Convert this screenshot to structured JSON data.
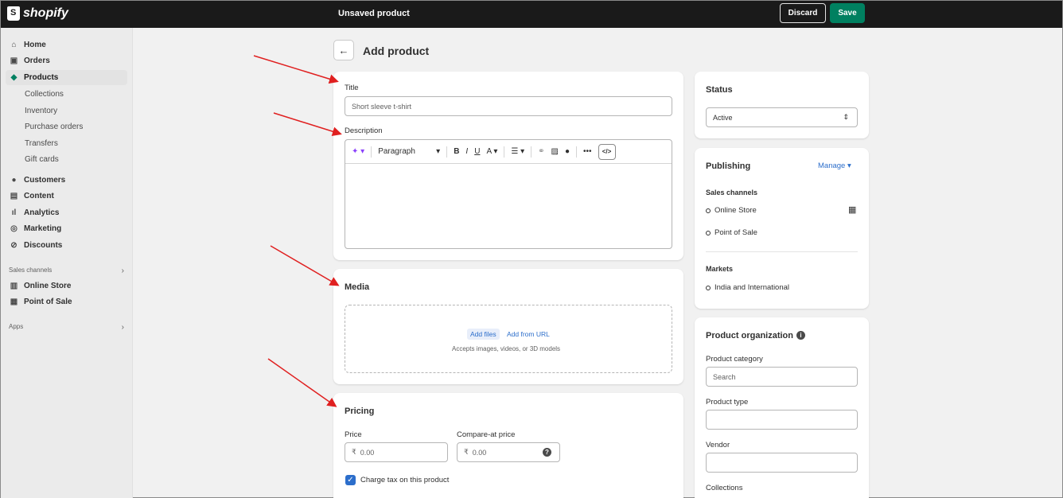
{
  "topbar": {
    "brand": "shopify",
    "status": "Unsaved product",
    "discard": "Discard",
    "save": "Save"
  },
  "sidebar": {
    "home": "Home",
    "orders": "Orders",
    "products": "Products",
    "products_sub": [
      "Collections",
      "Inventory",
      "Purchase orders",
      "Transfers",
      "Gift cards"
    ],
    "customers": "Customers",
    "content": "Content",
    "analytics": "Analytics",
    "marketing": "Marketing",
    "discounts": "Discounts",
    "sales_channels": "Sales channels",
    "online_store": "Online Store",
    "point_of_sale": "Point of Sale",
    "apps": "Apps"
  },
  "page": {
    "title": "Add product"
  },
  "title_field": {
    "label": "Title",
    "placeholder": "Short sleeve t-shirt"
  },
  "description": {
    "label": "Description",
    "paragraph": "Paragraph"
  },
  "media": {
    "heading": "Media",
    "add_files": "Add files",
    "add_from_url": "Add from URL",
    "accepts": "Accepts images, videos, or 3D models"
  },
  "pricing": {
    "heading": "Pricing",
    "price_label": "Price",
    "compare_label": "Compare-at price",
    "currency": "₹",
    "price_placeholder": "0.00",
    "compare_placeholder": "0.00",
    "charge_tax": "Charge tax on this product"
  },
  "status": {
    "heading": "Status",
    "value": "Active"
  },
  "publishing": {
    "heading": "Publishing",
    "manage": "Manage",
    "sales_channels": "Sales channels",
    "channels": [
      "Online Store",
      "Point of Sale"
    ],
    "markets": "Markets",
    "market_value": "India and International"
  },
  "organization": {
    "heading": "Product organization",
    "category_label": "Product category",
    "category_placeholder": "Search",
    "type_label": "Product type",
    "vendor_label": "Vendor",
    "collections_label": "Collections"
  },
  "colors": {
    "accent": "#008060",
    "link": "#2c6ecb",
    "annotation": "#e02020"
  }
}
